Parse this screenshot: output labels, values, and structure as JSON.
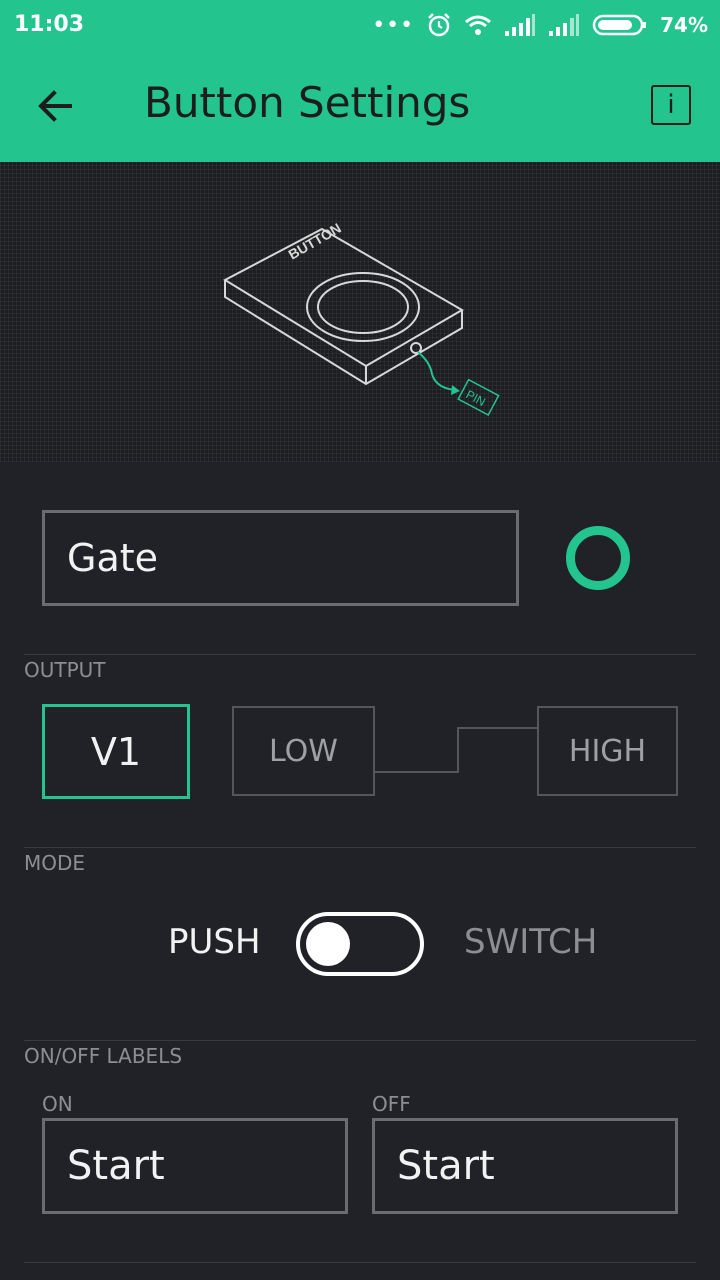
{
  "status_bar": {
    "time": "11:03",
    "battery": "74%"
  },
  "app_bar": {
    "title": "Button Settings",
    "info_label": "i"
  },
  "illustration": {
    "device_label": "BUTTON",
    "pin_label": "PIN"
  },
  "name_field": {
    "value": "Gate"
  },
  "accent_color": "#23c48e",
  "output": {
    "section_label": "OUTPUT",
    "pin": "V1",
    "low_label": "LOW",
    "high_label": "HIGH"
  },
  "mode": {
    "section_label": "MODE",
    "push_label": "PUSH",
    "switch_label": "SWITCH",
    "selected": "PUSH"
  },
  "labels": {
    "section_label": "ON/OFF LABELS",
    "on_label": "ON",
    "off_label": "OFF",
    "on_value": "Start",
    "off_value": "Start"
  }
}
